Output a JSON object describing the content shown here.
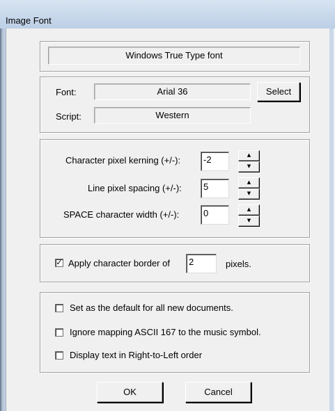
{
  "window": {
    "title": "Image Font"
  },
  "font_type": "Windows True Type font",
  "font": {
    "font_label": "Font:",
    "font_value": "Arial  36",
    "select_label": "Select",
    "script_label": "Script:",
    "script_value": "Western"
  },
  "spacing": {
    "kerning_label": "Character pixel kerning (+/-):",
    "kerning_value": "-2",
    "line_label": "Line pixel spacing (+/-):",
    "line_value": "5",
    "space_label": "SPACE character width (+/-):",
    "space_value": "0",
    "spin_up_glyph": "▲",
    "spin_down_glyph": "▼"
  },
  "border": {
    "checked": true,
    "check_glyph": "✓",
    "label": "Apply character border of",
    "value": "2",
    "unit": "pixels."
  },
  "options": [
    {
      "label": "Set as the default for all new documents.",
      "checked": false
    },
    {
      "label": "Ignore mapping ASCII 167 to the music symbol.",
      "checked": false
    },
    {
      "label": "Display text in Right-to-Left order",
      "checked": false
    }
  ],
  "buttons": {
    "ok": "OK",
    "cancel": "Cancel"
  }
}
